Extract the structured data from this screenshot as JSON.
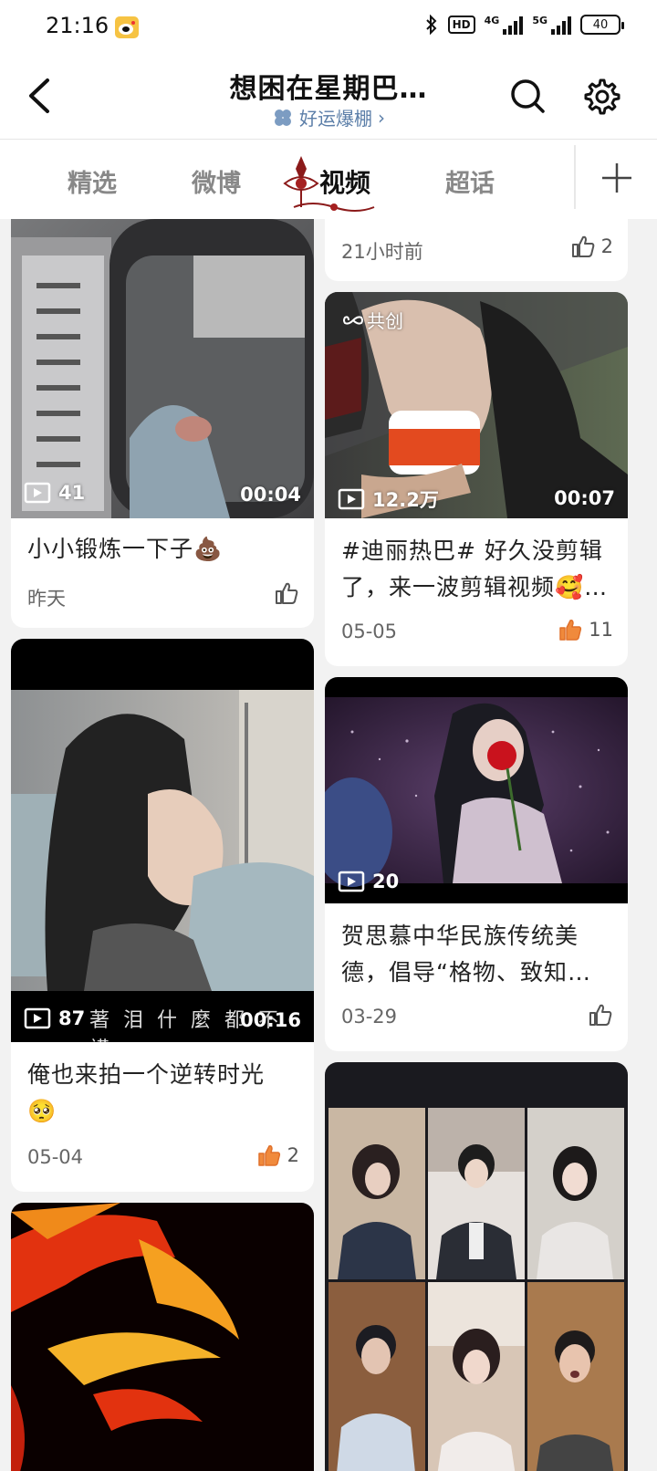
{
  "status_bar": {
    "time": "21:16",
    "hd_label": "HD",
    "net1": "4G",
    "net2": "5G",
    "battery": "40"
  },
  "header": {
    "title": "想困在星期巴…",
    "subtitle": "好运爆棚",
    "subtitle_chevron": "›"
  },
  "tabs": [
    {
      "label": "精选"
    },
    {
      "label": "微博"
    },
    {
      "label": "视频"
    },
    {
      "label": "超话"
    }
  ],
  "feed": {
    "left": [
      {
        "play_count": "41",
        "duration": "00:04",
        "caption": "小小锻炼一下子💩",
        "date": "昨天",
        "likes": ""
      },
      {
        "play_count": "87",
        "duration": "00:16",
        "subtitle_text": "著 泪 什 麼 都 不 講",
        "caption_line1": "俺也来拍一个逆转时光",
        "caption_line2": "🥺",
        "date": "05-04",
        "likes": "2"
      }
    ],
    "right": [
      {
        "date": "21小时前",
        "likes": "2"
      },
      {
        "badge": "共创",
        "play_count": "12.2万",
        "duration": "00:07",
        "caption_line1": "#迪丽热巴# 好久没剪辑",
        "caption_line2": "了，来一波剪辑视频🥰…",
        "date": "05-05",
        "likes": "11"
      },
      {
        "play_count": "20",
        "caption_line1": "贺思慕中华民族传统美",
        "caption_line2": "德，倡导“格物、致知…",
        "date": "03-29",
        "likes": ""
      }
    ]
  },
  "colors": {
    "liked": "#f08a3c",
    "link_blue": "#5b7ea8",
    "tab_active": "#111111",
    "tab_inactive": "#888888"
  }
}
